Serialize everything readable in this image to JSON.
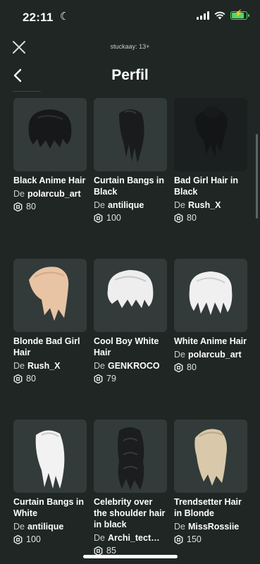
{
  "status": {
    "time": "22:11"
  },
  "header": {
    "account_label": "stuckaay: 13+",
    "title": "Perfil"
  },
  "items": [
    {
      "name": "Black Anime Hair",
      "creator_prefix": "De",
      "creator": "polarcub_art",
      "price": "80",
      "hair_color": "#16181a"
    },
    {
      "name": "Curtain Bangs in Black",
      "creator_prefix": "De",
      "creator": "antilique",
      "price": "100",
      "hair_color": "#1a1b1d"
    },
    {
      "name": "Bad Girl Hair in Black",
      "creator_prefix": "De",
      "creator": "Rush_X",
      "price": "80",
      "hair_color": "#141516"
    },
    {
      "name": "Blonde Bad Girl Hair",
      "creator_prefix": "De",
      "creator": "Rush_X",
      "price": "80",
      "hair_color": "#e8c3a4"
    },
    {
      "name": "Cool Boy White Hair",
      "creator_prefix": "De",
      "creator": "GENKROCO",
      "price": "79",
      "hair_color": "#eeeeee"
    },
    {
      "name": "White Anime Hair",
      "creator_prefix": "De",
      "creator": "polarcub_art",
      "price": "80",
      "hair_color": "#f0f0f0"
    },
    {
      "name": "Curtain Bangs in White",
      "creator_prefix": "De",
      "creator": "antilique",
      "price": "100",
      "hair_color": "#f2f2f2"
    },
    {
      "name": "Celebrity over the shoulder hair in black",
      "creator_prefix": "De",
      "creator": "Archi_tect…",
      "price": "85",
      "hair_color": "#1c1d1f"
    },
    {
      "name": "Trendsetter Hair in Blonde",
      "creator_prefix": "De",
      "creator": "MissRossiie",
      "price": "150",
      "hair_color": "#d9c8aa"
    }
  ],
  "icons": {
    "close": "close-icon",
    "back": "chevron-left-icon",
    "currency": "robux-icon"
  },
  "colors": {
    "background": "#1f2624",
    "card": "#323b39",
    "battery": "#4cd964"
  }
}
